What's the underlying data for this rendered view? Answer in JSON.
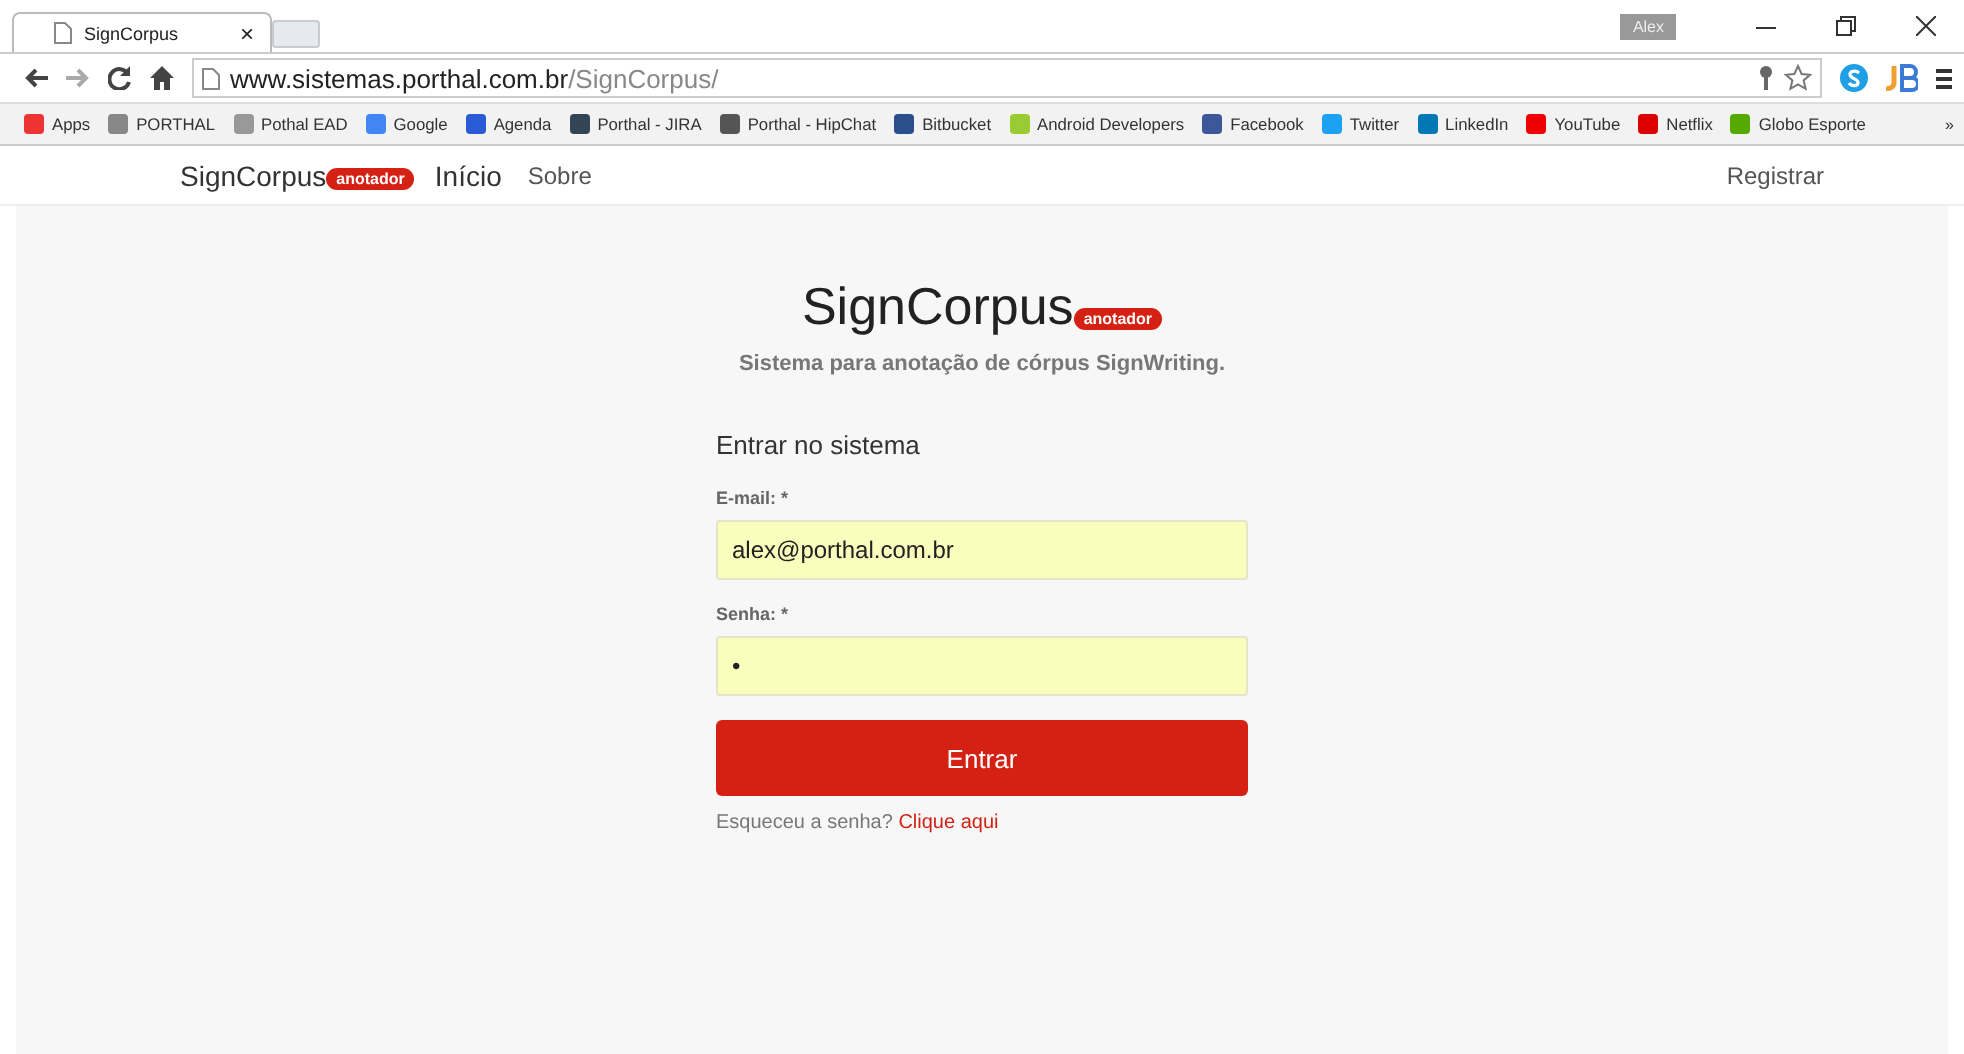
{
  "browser": {
    "tab": {
      "title": "SignCorpus",
      "close": "×"
    },
    "profile": "Alex",
    "address": {
      "host": "www.sistemas.porthal.com.br",
      "path": "/SignCorpus/"
    },
    "bookmarks": [
      {
        "label": "Apps"
      },
      {
        "label": "PORTHAL"
      },
      {
        "label": "Pothal EAD"
      },
      {
        "label": "Google"
      },
      {
        "label": "Agenda"
      },
      {
        "label": "Porthal - JIRA"
      },
      {
        "label": "Porthal - HipChat"
      },
      {
        "label": "Bitbucket"
      },
      {
        "label": "Android Developers"
      },
      {
        "label": "Facebook"
      },
      {
        "label": "Twitter"
      },
      {
        "label": "LinkedIn"
      },
      {
        "label": "YouTube"
      },
      {
        "label": "Netflix"
      },
      {
        "label": "Globo Esporte"
      }
    ],
    "more": "»"
  },
  "navbar": {
    "brand": "SignCorpus",
    "badge": "anotador",
    "links": [
      {
        "label": "Início"
      },
      {
        "label": "Sobre"
      }
    ],
    "register": "Registrar"
  },
  "hero": {
    "title": "SignCorpus",
    "badge": "anotador",
    "subtitle": "Sistema para anotação de córpus SignWriting."
  },
  "form": {
    "heading": "Entrar no sistema",
    "fields": [
      {
        "label": "E-mail: *",
        "value": "alex@porthal.com.br"
      },
      {
        "label": "Senha: *",
        "value": "•"
      }
    ],
    "submit": "Entrar",
    "forgot": "Esqueceu a senha?",
    "forgot_link": "Clique aqui"
  }
}
